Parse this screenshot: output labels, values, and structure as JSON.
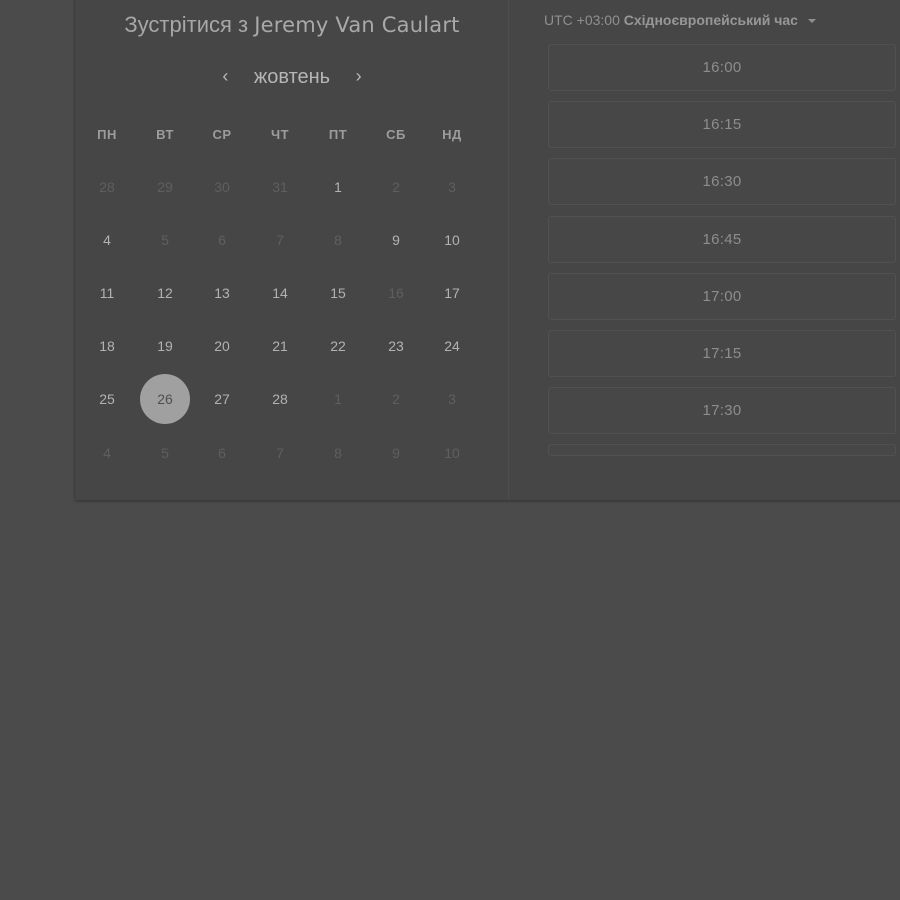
{
  "header": {
    "meet_prefix": "Зустрітися з",
    "host_name": "Jeremy Van Caulart"
  },
  "calendar": {
    "month": "жовтень",
    "prev_icon": "chevron-left-icon",
    "next_icon": "chevron-right-icon",
    "weekdays": [
      "ПН",
      "ВТ",
      "СР",
      "ЧТ",
      "ПТ",
      "СБ",
      "НД"
    ],
    "weeks": [
      [
        {
          "d": "28",
          "enabled": false
        },
        {
          "d": "29",
          "enabled": false
        },
        {
          "d": "30",
          "enabled": false
        },
        {
          "d": "31",
          "enabled": false
        },
        {
          "d": "1",
          "enabled": true
        },
        {
          "d": "2",
          "enabled": false
        },
        {
          "d": "3",
          "enabled": false
        }
      ],
      [
        {
          "d": "4",
          "enabled": true
        },
        {
          "d": "5",
          "enabled": false
        },
        {
          "d": "6",
          "enabled": false
        },
        {
          "d": "7",
          "enabled": false
        },
        {
          "d": "8",
          "enabled": false
        },
        {
          "d": "9",
          "enabled": true
        },
        {
          "d": "10",
          "enabled": true
        }
      ],
      [
        {
          "d": "11",
          "enabled": true
        },
        {
          "d": "12",
          "enabled": true
        },
        {
          "d": "13",
          "enabled": true
        },
        {
          "d": "14",
          "enabled": true
        },
        {
          "d": "15",
          "enabled": true
        },
        {
          "d": "16",
          "enabled": false
        },
        {
          "d": "17",
          "enabled": true
        }
      ],
      [
        {
          "d": "18",
          "enabled": true
        },
        {
          "d": "19",
          "enabled": true
        },
        {
          "d": "20",
          "enabled": true
        },
        {
          "d": "21",
          "enabled": true
        },
        {
          "d": "22",
          "enabled": true
        },
        {
          "d": "23",
          "enabled": true
        },
        {
          "d": "24",
          "enabled": true
        }
      ],
      [
        {
          "d": "25",
          "enabled": true
        },
        {
          "d": "26",
          "enabled": true,
          "selected": true
        },
        {
          "d": "27",
          "enabled": true
        },
        {
          "d": "28",
          "enabled": true
        },
        {
          "d": "1",
          "enabled": false
        },
        {
          "d": "2",
          "enabled": false
        },
        {
          "d": "3",
          "enabled": false
        }
      ],
      [
        {
          "d": "4",
          "enabled": false
        },
        {
          "d": "5",
          "enabled": false
        },
        {
          "d": "6",
          "enabled": false
        },
        {
          "d": "7",
          "enabled": false
        },
        {
          "d": "8",
          "enabled": false
        },
        {
          "d": "9",
          "enabled": false
        },
        {
          "d": "10",
          "enabled": false
        }
      ]
    ]
  },
  "timezone": {
    "offset": "UTC +03:00",
    "name": "Східноєвропейський час"
  },
  "time_slots": [
    "16:00",
    "16:15",
    "16:30",
    "16:45",
    "17:00",
    "17:15",
    "17:30",
    ""
  ]
}
